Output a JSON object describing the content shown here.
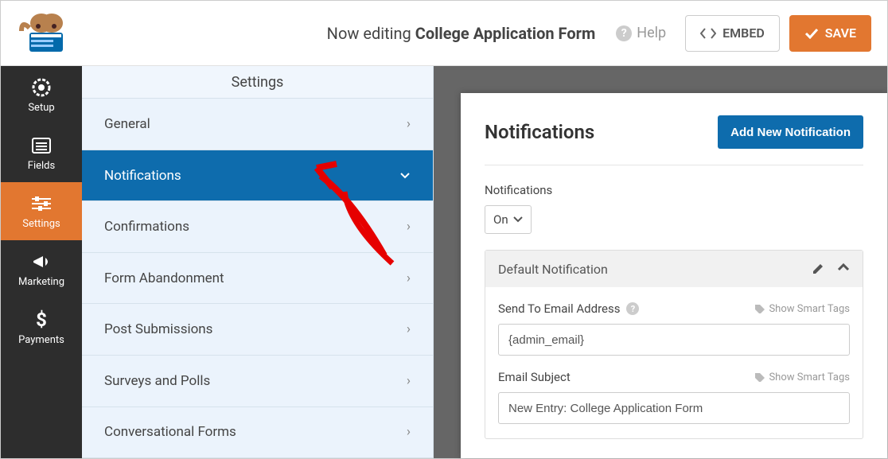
{
  "topbar": {
    "editing_prefix": "Now editing",
    "form_name": "College Application Form",
    "help": "Help",
    "embed": "EMBED",
    "save": "SAVE"
  },
  "sidebar": {
    "items": [
      {
        "label": "Setup"
      },
      {
        "label": "Fields"
      },
      {
        "label": "Settings"
      },
      {
        "label": "Marketing"
      },
      {
        "label": "Payments"
      }
    ]
  },
  "submenu": {
    "header": "Settings",
    "items": [
      {
        "label": "General"
      },
      {
        "label": "Notifications"
      },
      {
        "label": "Confirmations"
      },
      {
        "label": "Form Abandonment"
      },
      {
        "label": "Post Submissions"
      },
      {
        "label": "Surveys and Polls"
      },
      {
        "label": "Conversational Forms"
      }
    ]
  },
  "panel": {
    "title": "Notifications",
    "add_button": "Add New Notification",
    "section_label": "Notifications",
    "toggle_value": "On",
    "card_title": "Default Notification",
    "smart_tags": "Show Smart Tags",
    "fields": {
      "send_to": {
        "label": "Send To Email Address",
        "value": "{admin_email}"
      },
      "subject": {
        "label": "Email Subject",
        "value": "New Entry: College Application Form"
      }
    }
  }
}
